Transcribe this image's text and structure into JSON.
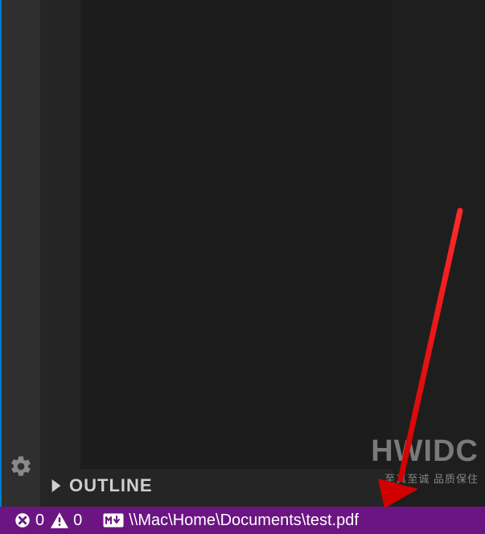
{
  "sidebar": {
    "outline_label": "OUTLINE"
  },
  "statusbar": {
    "errors_count": "0",
    "warnings_count": "0",
    "file_path": "\\\\Mac\\Home\\Documents\\test.pdf"
  },
  "watermark": {
    "title": "HWIDC",
    "subtitle": "至真至诚 品质保住"
  },
  "icons": {
    "gear": "gear-icon",
    "chevron_right": "chevron-right-icon",
    "error_circle": "error-circle-icon",
    "warning_triangle": "warning-triangle-icon",
    "markdown": "markdown-icon"
  },
  "colors": {
    "statusbar_bg": "#6b1582",
    "accent_left_border": "#007acc",
    "panel_bg": "#252526",
    "inner_bg": "#1c1c1c",
    "rail_bg": "#2f2f2f",
    "editor_bg": "#1e1e1e"
  }
}
